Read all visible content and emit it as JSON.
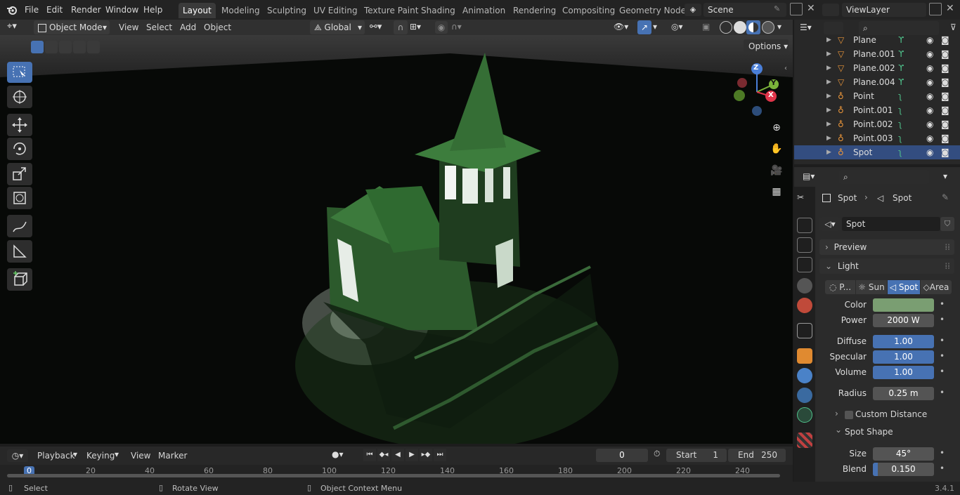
{
  "topbar": {
    "menus": [
      "File",
      "Edit",
      "Render",
      "Window",
      "Help"
    ],
    "workspaces": [
      "Layout",
      "Modeling",
      "Sculpting",
      "UV Editing",
      "Texture Paint",
      "Shading",
      "Animation",
      "Rendering",
      "Compositing",
      "Geometry Node"
    ],
    "active_workspace": "Layout",
    "scene": "Scene",
    "view_layer": "ViewLayer"
  },
  "viewport_header": {
    "mode": "Object Mode",
    "menus": [
      "View",
      "Select",
      "Add",
      "Object"
    ],
    "orientation": "Global",
    "options": "Options"
  },
  "gizmo": {
    "z": "Z",
    "y": "Y",
    "x": "X"
  },
  "outliner": {
    "items": [
      {
        "name": "Plane",
        "type": "mesh"
      },
      {
        "name": "Plane.001",
        "type": "mesh"
      },
      {
        "name": "Plane.002",
        "type": "mesh"
      },
      {
        "name": "Plane.004",
        "type": "mesh"
      },
      {
        "name": "Point",
        "type": "light"
      },
      {
        "name": "Point.001",
        "type": "light"
      },
      {
        "name": "Point.002",
        "type": "light"
      },
      {
        "name": "Point.003",
        "type": "light"
      },
      {
        "name": "Spot",
        "type": "light",
        "selected": true
      }
    ]
  },
  "properties": {
    "breadcrumb_object": "Spot",
    "breadcrumb_data": "Spot",
    "datablock": "Spot",
    "preview": "Preview",
    "light": "Light",
    "light_types": [
      "P...",
      "Sun",
      "Spot",
      "Area"
    ],
    "active_light_type": "Spot",
    "color_label": "Color",
    "color_value": "#7a9e72",
    "power_label": "Power",
    "power": "2000 W",
    "diffuse_label": "Diffuse",
    "diffuse": "1.00",
    "specular_label": "Specular",
    "specular": "1.00",
    "volume_label": "Volume",
    "volume": "1.00",
    "radius_label": "Radius",
    "radius": "0.25 m",
    "custom_distance": "Custom Distance",
    "spot_shape": "Spot Shape",
    "size_label": "Size",
    "size": "45°",
    "blend_label": "Blend",
    "blend": "0.150"
  },
  "timeline": {
    "menus": [
      "Playback",
      "Keying",
      "View",
      "Marker"
    ],
    "current_frame": "0",
    "start_label": "Start",
    "start": "1",
    "end_label": "End",
    "end": "250",
    "ruler": [
      "0",
      "20",
      "40",
      "60",
      "80",
      "100",
      "120",
      "140",
      "160",
      "180",
      "200",
      "220",
      "240"
    ]
  },
  "statusbar": {
    "select": "Select",
    "rotate": "Rotate View",
    "context": "Object Context Menu",
    "version": "3.4.1"
  },
  "colors": {
    "accent": "#4772b3",
    "selected_row": "#334d80",
    "house_green": "#3a6b3a"
  }
}
